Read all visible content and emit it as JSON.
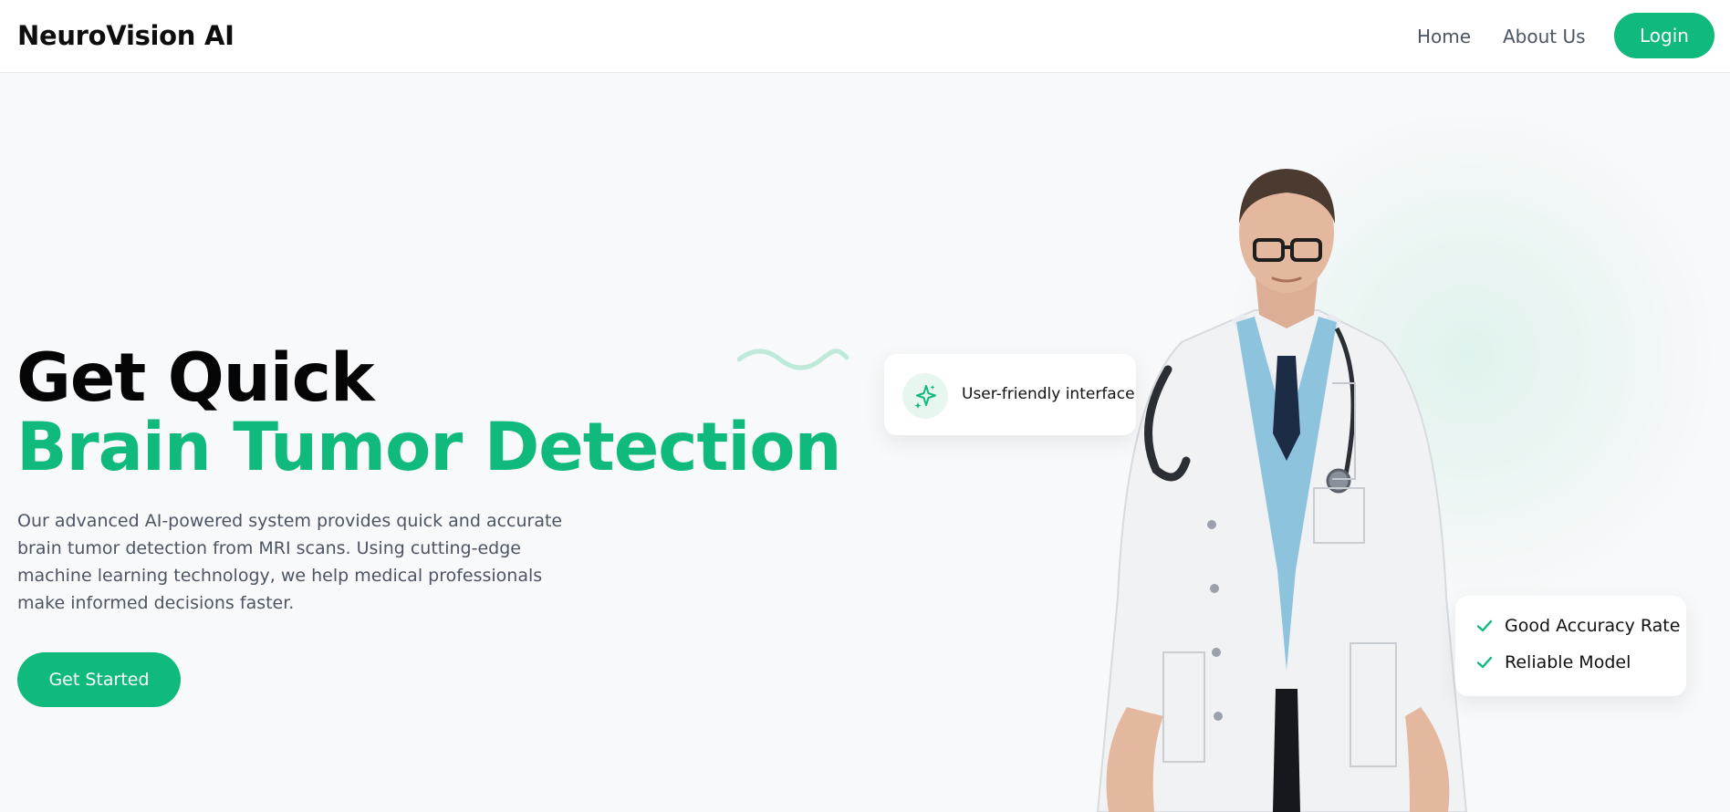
{
  "header": {
    "brand": "NeuroVision AI",
    "nav": {
      "home": "Home",
      "about": "About Us"
    },
    "login_label": "Login"
  },
  "hero": {
    "title_line1": "Get Quick",
    "title_line2": "Brain Tumor Detection",
    "description": "Our advanced AI-powered system provides quick and accurate brain tumor detection from MRI scans. Using cutting-edge machine learning technology, we help medical professionals make informed decisions faster.",
    "cta_label": "Get Started"
  },
  "cards": {
    "ui_card": {
      "icon": "sparkles-icon",
      "text": "User-friendly interface"
    },
    "features": [
      {
        "icon": "check-icon",
        "text": "Good Accuracy Rate"
      },
      {
        "icon": "check-icon",
        "text": "Reliable Model"
      }
    ]
  },
  "colors": {
    "accent": "#10b97c",
    "text_dark": "#0d0d0d",
    "text_muted": "#4b5563",
    "background": "#f8f9fa"
  }
}
